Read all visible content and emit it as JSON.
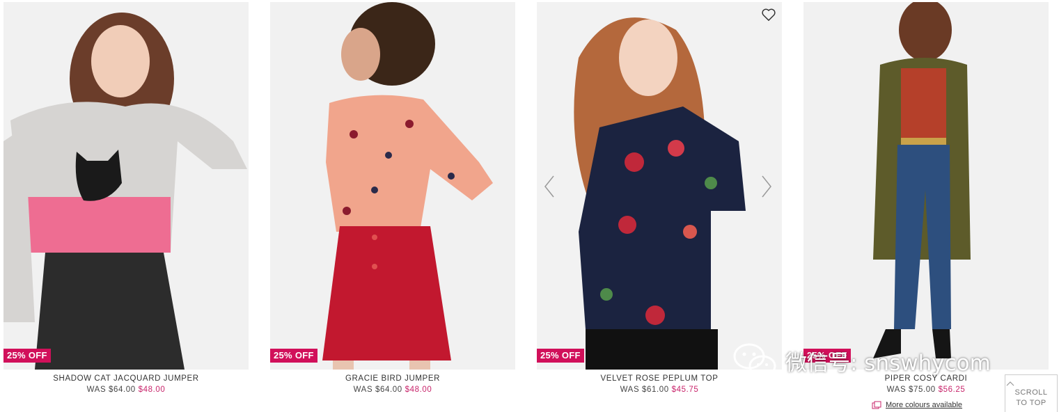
{
  "products": [
    {
      "name": "SHADOW CAT JACQUARD JUMPER",
      "was": "WAS $64.00",
      "sale": "$48.00",
      "badge": "25% OFF"
    },
    {
      "name": "GRACIE BIRD JUMPER",
      "was": "WAS $64.00",
      "sale": "$48.00",
      "badge": "25% OFF"
    },
    {
      "name": "VELVET ROSE PEPLUM TOP",
      "was": "WAS $61.00",
      "sale": "$45.75",
      "badge": "25% OFF"
    },
    {
      "name": "PIPER COSY CARDI",
      "was": "WAS $75.00",
      "sale": "$56.25",
      "badge": "25% OFF",
      "more_colours": "More colours available"
    }
  ],
  "scroll_top": {
    "line1": "SCROLL",
    "line2": "TO TOP"
  },
  "watermark": {
    "text": "微信号: snswhycom"
  },
  "colors": {
    "badge": "#d1105a",
    "sale_price": "#c8246b"
  }
}
